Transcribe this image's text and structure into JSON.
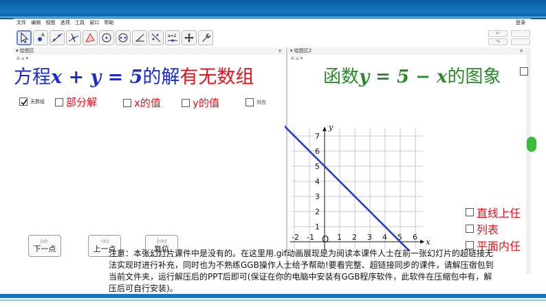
{
  "menu": {
    "items": [
      "文件",
      "编辑",
      "视图",
      "选项",
      "工具",
      "窗口",
      "帮助"
    ],
    "hint": "登录"
  },
  "toolbar": {
    "tools": [
      "move-tool",
      "point-tool",
      "line-tool",
      "perpendicular-tool",
      "polygon-tool",
      "circle-tool",
      "ellipse-tool",
      "angle-tool",
      "reflect-tool",
      "slider-tool",
      "move-view-tool",
      "settings-tool"
    ],
    "undo_label": "↶",
    "redo_label": "↷"
  },
  "panels": {
    "left_title": "绘图区",
    "right_title": "绘图区2",
    "close": "×",
    "style_bar": "A ⌂ ▾"
  },
  "left": {
    "heading_prefix": "方程",
    "heading_math": "x + y = 5",
    "heading_mid": "的解",
    "heading_red": "有无数组",
    "checkboxes": [
      {
        "label": "无数组",
        "checked": true
      },
      {
        "label": "部分解",
        "checked": false
      },
      {
        "label": "x的值",
        "checked": false
      },
      {
        "label": "y的值",
        "checked": false
      },
      {
        "label": "对应",
        "checked": false
      }
    ],
    "nav": [
      {
        "icon": "▷▷",
        "label": "下一点"
      },
      {
        "icon": "◁◁",
        "label": "上一点"
      },
      {
        "icon": "|◁◁",
        "label": "复位"
      }
    ]
  },
  "right": {
    "heading_prefix": "函数",
    "heading_math": "y = 5 − x",
    "heading_suffix": "的图象",
    "side_checkboxes": [
      "直线上任",
      "列表",
      "平面内任"
    ],
    "graph": {
      "x_label": "x",
      "y_label": "y",
      "origin_label": "O",
      "x_ticks": [
        "-2",
        "-1",
        "1",
        "2",
        "3",
        "4",
        "5",
        "6"
      ],
      "y_ticks": [
        "1",
        "2",
        "3",
        "4",
        "5",
        "6",
        "7"
      ]
    }
  },
  "note": "注意：本张幻灯片课件中是没有的。在这里用.gif动画展现是为阅读本课件人士在前一张幻灯片的超链接无法实现时进行补充，同时也为不熟练GGB操作人士给予帮助!要看完整、超链接同步的课件，请解压宿包到当前文件夹，运行解压后的PPT后即可(保证在你的电脑中安装有GGB程序软件，此软件在压缩包中有，解压后可自行安装)。",
  "chart_data": {
    "type": "line",
    "title": "",
    "xlabel": "x",
    "ylabel": "y",
    "xlim": [
      -2.3,
      6.6
    ],
    "ylim": [
      -0.7,
      7.6
    ],
    "grid": true,
    "series": [
      {
        "name": "",
        "x": [
          -3,
          7
        ],
        "y": [
          8,
          -2
        ],
        "color": "#1f3fcf"
      }
    ]
  }
}
